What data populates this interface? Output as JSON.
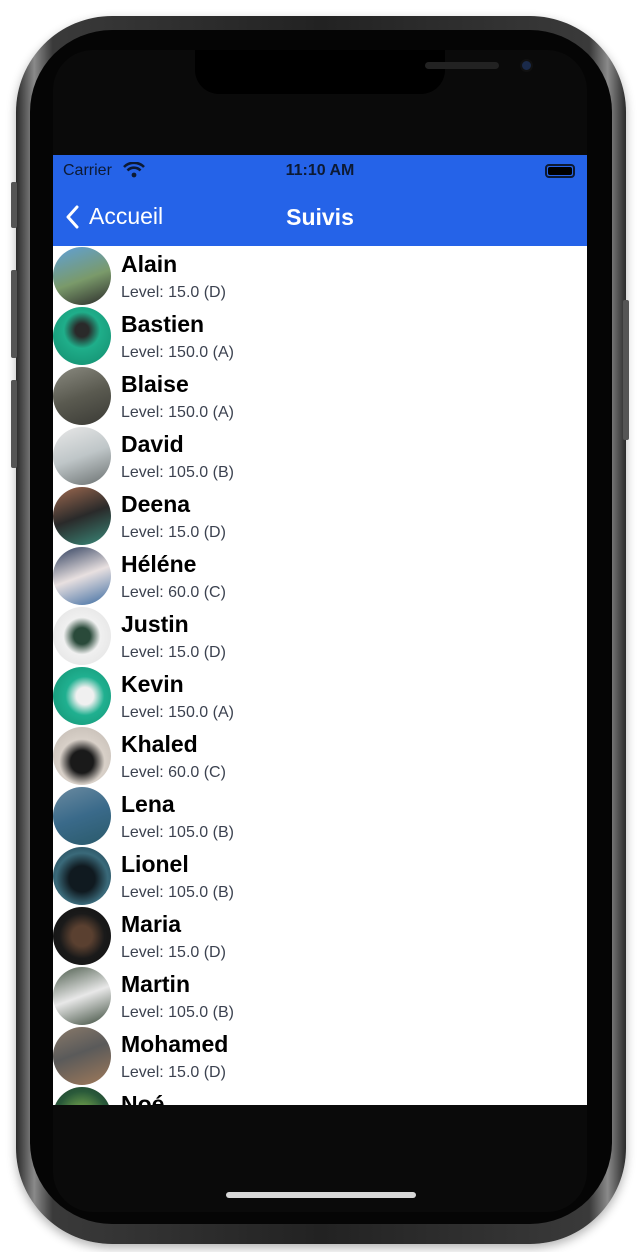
{
  "status_bar": {
    "carrier": "Carrier",
    "time": "11:10 AM"
  },
  "nav": {
    "back_label": "Accueil",
    "title": "Suivis"
  },
  "colors": {
    "accent": "#2563e8"
  },
  "players": [
    {
      "name": "Alain",
      "level": "Level: 15.0 (D)",
      "avatar": "linear-gradient(160deg,#5fa0d8,#7a9a6a 55%,#2a2a2a)"
    },
    {
      "name": "Bastien",
      "level": "Level: 150.0 (A)",
      "avatar": "radial-gradient(circle at 50% 40%,#2a2a2a 15%,#1fae8a 40%,#128a6c)"
    },
    {
      "name": "Blaise",
      "level": "Level: 150.0 (A)",
      "avatar": "linear-gradient(160deg,#8a8a80,#5a5a50 50%,#3a3a35)"
    },
    {
      "name": "David",
      "level": "Level: 105.0 (B)",
      "avatar": "linear-gradient(160deg,#e8e8e8,#bfc6c8 50%,#6a7070)"
    },
    {
      "name": "Deena",
      "level": "Level: 15.0 (D)",
      "avatar": "linear-gradient(160deg,#a06a50,#2a2a2a 50%,#3a8a7a)"
    },
    {
      "name": "Héléne",
      "level": "Level: 60.0 (C)",
      "avatar": "linear-gradient(160deg,#2a3a5a,#e8e0e0 50%,#3a6aa0)"
    },
    {
      "name": "Justin",
      "level": "Level: 15.0 (D)",
      "avatar": "radial-gradient(circle at 50% 50%,#2a4a3a 20%,#f0f0f0 45%,#e0e0e0)"
    },
    {
      "name": "Kevin",
      "level": "Level: 150.0 (A)",
      "avatar": "radial-gradient(circle at 55% 50%,#f0f0f0 20%,#20b090 45%,#129070)"
    },
    {
      "name": "Khaled",
      "level": "Level: 60.0 (C)",
      "avatar": "radial-gradient(circle at 50% 60%,#1a1a1a 25%,#d8d0c8 50%,#c0b8b0)"
    },
    {
      "name": "Lena",
      "level": "Level: 105.0 (B)",
      "avatar": "linear-gradient(160deg,#6a8aa0,#3a6a8a 50%,#2a5a6a)"
    },
    {
      "name": "Lionel",
      "level": "Level: 105.0 (B)",
      "avatar": "radial-gradient(circle at 50% 55%,#101a20 30%,#3a6a7a 60%,#1a3a4a)"
    },
    {
      "name": "Maria",
      "level": "Level: 15.0 (D)",
      "avatar": "radial-gradient(circle at 50% 50%,#5a4030 25%,#1a1a1a 55%,#101010)"
    },
    {
      "name": "Martin",
      "level": "Level: 105.0 (B)",
      "avatar": "linear-gradient(160deg,#4a5a4a,#e8e8e8 50%,#3a4a3a)"
    },
    {
      "name": "Mohamed",
      "level": "Level: 15.0 (D)",
      "avatar": "linear-gradient(160deg,#8a7a6a,#5a5a5a 45%,#a07a5a)"
    },
    {
      "name": "Noé",
      "level": "",
      "avatar": "radial-gradient(circle at 50% 50%,#6a9a4a 20%,#2a5a3a 60%,#1a3a2a)"
    }
  ]
}
